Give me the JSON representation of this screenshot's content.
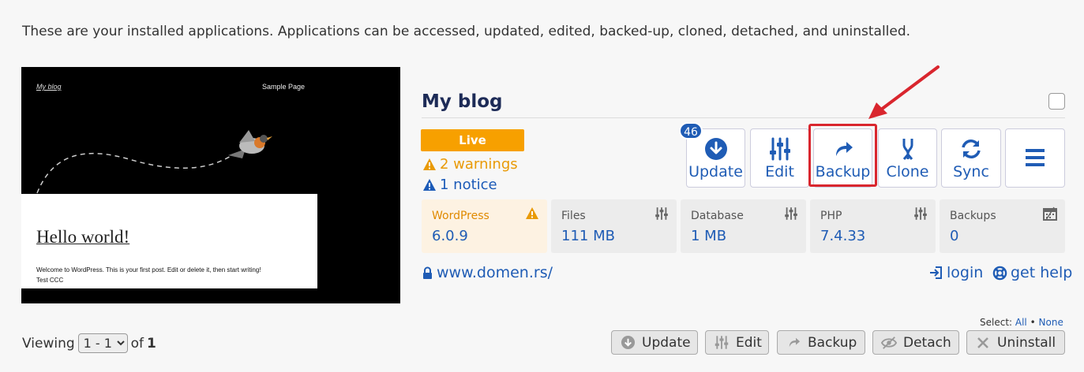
{
  "intro_text": "These are your installed applications. Applications can be accessed, updated, edited, backed-up, cloned, detached, and uninstalled.",
  "thumbnail": {
    "site_title": "My blog",
    "nav_link": "Sample Page",
    "post_title": "Hello world!",
    "post_body": "Welcome to WordPress. This is your first post. Edit or delete it, then start writing!",
    "post_extra": "Test CCC"
  },
  "app": {
    "title": "My blog",
    "status": "Live",
    "warnings": "2 warnings",
    "notices": "1 notice",
    "update_count": "46",
    "url": "www.domen.rs/",
    "login_label": "login",
    "help_label": "get help"
  },
  "actions": [
    {
      "label": "Update",
      "icon": "download-circle-icon"
    },
    {
      "label": "Edit",
      "icon": "sliders-icon"
    },
    {
      "label": "Backup",
      "icon": "share-arrow-icon"
    },
    {
      "label": "Clone",
      "icon": "fork-icon"
    },
    {
      "label": "Sync",
      "icon": "sync-icon"
    },
    {
      "label": "",
      "icon": "hamburger-menu-icon"
    }
  ],
  "info": [
    {
      "label": "WordPress",
      "value": "6.0.9",
      "icon": "warning-icon"
    },
    {
      "label": "Files",
      "value": "111 MB",
      "icon": "sliders-icon"
    },
    {
      "label": "Database",
      "value": "1 MB",
      "icon": "sliders-icon"
    },
    {
      "label": "PHP",
      "value": "7.4.33",
      "icon": "sliders-icon"
    },
    {
      "label": "Backups",
      "value": "0",
      "icon": "calendar-icon"
    }
  ],
  "pagination": {
    "viewing_label": "Viewing",
    "range": "1 - 1",
    "of_label": "of",
    "total": "1"
  },
  "select": {
    "label": "Select:",
    "all": "All",
    "sep": "•",
    "none": "None"
  },
  "bulk": [
    {
      "label": "Update",
      "icon": "download-circle-icon"
    },
    {
      "label": "Edit",
      "icon": "sliders-icon"
    },
    {
      "label": "Backup",
      "icon": "share-arrow-icon"
    },
    {
      "label": "Detach",
      "icon": "eye-slash-icon"
    },
    {
      "label": "Uninstall",
      "icon": "close-icon"
    }
  ],
  "colors": {
    "primary": "#1f5cb5",
    "live": "#f7a000",
    "warning": "#e99a06",
    "highlight": "#d9262e",
    "title": "#1d2b57"
  }
}
